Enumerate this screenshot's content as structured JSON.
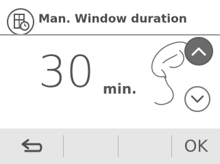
{
  "header": {
    "title": "Man. Window duration",
    "icon": "window-timer-icon"
  },
  "main": {
    "value": "30",
    "unit": "min.",
    "illustration": "hand-pointing-icon"
  },
  "controls": {
    "up_icon": "chevron-up-icon",
    "down_icon": "chevron-down-icon"
  },
  "footer": {
    "back_icon": "back-arrow-icon",
    "ok_label": "OK"
  },
  "colors": {
    "background": "#ffffff",
    "text": "#555555",
    "footer_bg": "#e6e6e6",
    "active_button": "#6b6b6b"
  }
}
